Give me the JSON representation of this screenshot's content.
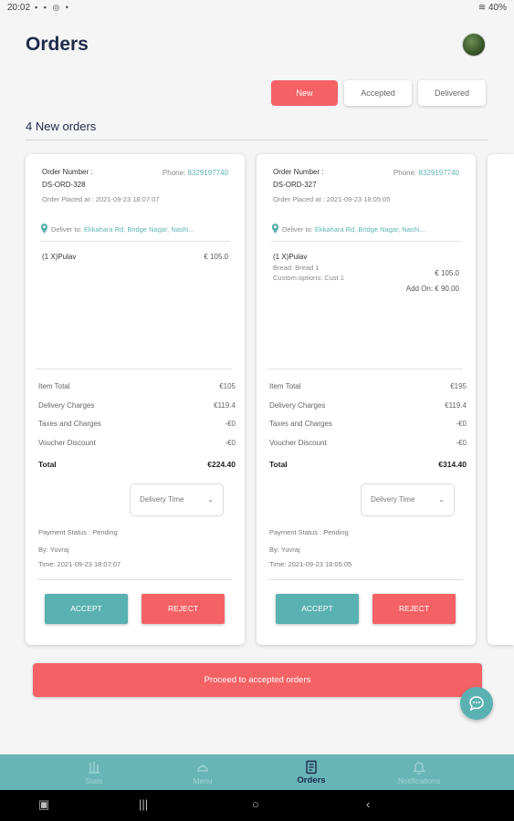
{
  "status_bar": {
    "time": "20:02",
    "battery": "40%"
  },
  "header": {
    "title": "Orders"
  },
  "tabs": [
    {
      "label": "New",
      "active": true
    },
    {
      "label": "Accepted",
      "active": false
    },
    {
      "label": "Delivered",
      "active": false
    }
  ],
  "orders_count_label": "4 New orders",
  "orders": [
    {
      "order_number_label": "Order Number :",
      "order_number": "DS-ORD-328",
      "phone_label": "Phone:",
      "phone": "8329197740",
      "placed_at": "Order Placed at : 2021-09-23 18:07:07",
      "deliver_label": "Deliver to:",
      "address": "Ekkahara Rd, Bridge Nagar, Nashi...",
      "item_name": "(1 X)Pulav",
      "item_price": "€ 105.0",
      "item_total_label": "Item Total",
      "item_total": "€105",
      "delivery_charges_label": "Delivery Charges",
      "delivery_charges": "€119.4",
      "taxes_label": "Taxes and Charges",
      "taxes": "-€0",
      "voucher_label": "Voucher Discount",
      "voucher": "-€0",
      "total_label": "Total",
      "total": "€224.40",
      "delivery_time_placeholder": "Delivery Time",
      "payment_status": "Payment Status : Pending",
      "by": "By: Yuvraj",
      "time": "Time: 2021-09-23 18:07:07",
      "accept_label": "ACCEPT",
      "reject_label": "REJECT"
    },
    {
      "order_number_label": "Order Number :",
      "order_number": "DS-ORD-327",
      "phone_label": "Phone:",
      "phone": "8329197740",
      "placed_at": "Order Placed at : 2021-09-23 18:05:05",
      "deliver_label": "Deliver to:",
      "address": "Ekkahara Rd, Bridge Nagar, Nashi...",
      "item_name": "(1 X)Pulav",
      "item_sub_1": "Bread: Bread 1",
      "item_sub_2": "Custom options: Cust 1",
      "item_price": "€ 105.0",
      "addon": "Add On: € 90.00",
      "item_total_label": "Item Total",
      "item_total": "€195",
      "delivery_charges_label": "Delivery Charges",
      "delivery_charges": "€119.4",
      "taxes_label": "Taxes and Charges",
      "taxes": "-€0",
      "voucher_label": "Voucher Discount",
      "voucher": "-€0",
      "total_label": "Total",
      "total": "€314.40",
      "delivery_time_placeholder": "Delivery Time",
      "payment_status": "Payment Status : Pending",
      "by": "By: Yuvraj",
      "time": "Time: 2021-09-23 18:05:05",
      "accept_label": "ACCEPT",
      "reject_label": "REJECT"
    }
  ],
  "proceed_label": "Proceed to accepted orders",
  "bottom_nav": [
    {
      "label": "Stats",
      "icon": "stats-icon",
      "active": false
    },
    {
      "label": "Menu",
      "icon": "menu-cloche-icon",
      "active": false
    },
    {
      "label": "Orders",
      "icon": "orders-icon",
      "active": true
    },
    {
      "label": "Notifications",
      "icon": "bell-icon",
      "active": false
    }
  ],
  "colors": {
    "accent_red": "#f46266",
    "accent_teal": "#5ab1b2",
    "nav_bg": "#68b5b7",
    "title": "#1e2a4a"
  }
}
